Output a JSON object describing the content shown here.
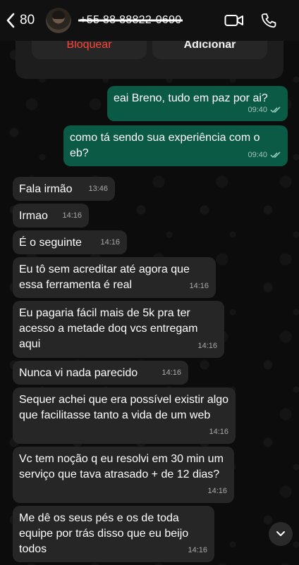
{
  "header": {
    "back_count": "80",
    "contact_name": "+55 88 88822-0690",
    "icons": {
      "back": "chevron-left-icon",
      "video": "video-call-icon",
      "call": "phone-icon"
    }
  },
  "info_card": {
    "block_label": "Bloquear",
    "add_label": "Adicionar",
    "colors": {
      "block": "#ff453a"
    }
  },
  "messages": [
    {
      "direction": "out",
      "text": "eai Breno, tudo em paz por ai?",
      "time": "09:40",
      "status": "read"
    },
    {
      "direction": "out",
      "text": "como tá sendo sua experiência com o eb?",
      "time": "09:40",
      "status": "read"
    },
    {
      "direction": "in",
      "text": "Fala irmão",
      "time": "13:46"
    },
    {
      "direction": "in",
      "text": "Irmao",
      "time": "14:16"
    },
    {
      "direction": "in",
      "text": "É o seguinte",
      "time": "14:16"
    },
    {
      "direction": "in",
      "text": "Eu tô sem acreditar até agora que essa ferramenta é real",
      "time": "14:16"
    },
    {
      "direction": "in",
      "text": "Eu pagaria fácil mais de 5k pra ter acesso a metade doq vcs entregam aqui",
      "time": "14:16"
    },
    {
      "direction": "in",
      "text": "Nunca vi nada parecido",
      "time": "14:16"
    },
    {
      "direction": "in",
      "text": "Sequer achei que era possível existir algo que facilitasse tanto a vida de um web",
      "time": "14:16"
    },
    {
      "direction": "in",
      "text": "Vc tem noção q eu resolvi em 30 min um serviço que tava atrasado + de 12 dias?",
      "time": "14:16"
    },
    {
      "direction": "in",
      "text": "Me dê os seus pés e os de toda equipe por trás disso que eu beijo todos",
      "time": "14:16"
    }
  ],
  "colors": {
    "outgoing_bubble": "#0b5a45",
    "incoming_bubble": "#262626",
    "read_ticks": "#9fd7c7"
  },
  "scroll_button_icon": "chevron-down-icon"
}
